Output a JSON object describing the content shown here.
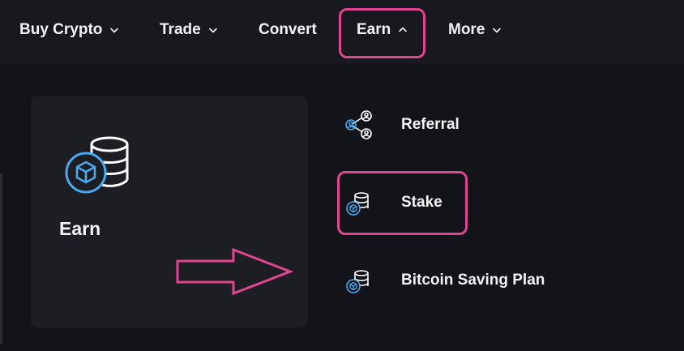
{
  "nav": {
    "items": [
      {
        "label": "Buy Crypto",
        "chevron": "down"
      },
      {
        "label": "Trade",
        "chevron": "down"
      },
      {
        "label": "Convert"
      },
      {
        "label": "Earn",
        "chevron": "up",
        "active": true
      },
      {
        "label": "More",
        "chevron": "down"
      }
    ]
  },
  "dropdown": {
    "feature": {
      "title": "Earn",
      "icon": "staking-database-icon"
    },
    "items": [
      {
        "label": "Referral",
        "icon": "referral-users-icon"
      },
      {
        "label": "Stake",
        "icon": "stake-database-icon"
      },
      {
        "label": "Bitcoin Saving Plan",
        "icon": "saving-plan-database-icon"
      }
    ]
  },
  "colors": {
    "background": "#131419",
    "nav_background": "#18191e",
    "card_background": "#1d1e24",
    "annotation": "#e0458f",
    "icon_accent": "#4aa8f0",
    "text": "#f2f2f2"
  }
}
